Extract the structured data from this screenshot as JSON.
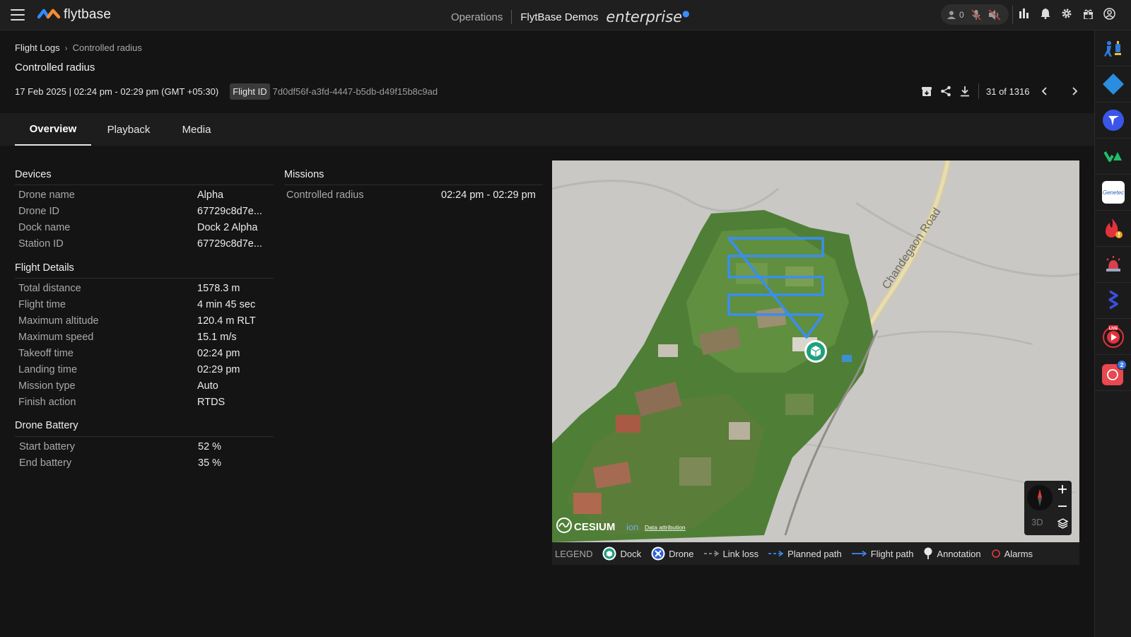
{
  "topbar": {
    "brand": "flytbase",
    "nav_operations": "Operations",
    "org_name": "FlytBase Demos",
    "edition": "enterprise",
    "user_count": "0"
  },
  "breadcrumb": {
    "root": "Flight Logs",
    "current": "Controlled radius"
  },
  "page_title": "Controlled radius",
  "meta": {
    "date_range": "17 Feb 2025 | 02:24 pm - 02:29 pm (GMT +05:30)",
    "flight_id_label": "Flight ID",
    "flight_id": "7d0df56f-a3fd-4447-b5db-d49f15b8c9ad",
    "pager": "31 of 1316"
  },
  "tabs": [
    {
      "label": "Overview",
      "active": true
    },
    {
      "label": "Playback",
      "active": false
    },
    {
      "label": "Media",
      "active": false
    }
  ],
  "devices": {
    "heading": "Devices",
    "rows": [
      {
        "label": "Drone name",
        "value": "Alpha"
      },
      {
        "label": "Drone ID",
        "value": "67729c8d7e..."
      },
      {
        "label": "Dock name",
        "value": "Dock 2 Alpha"
      },
      {
        "label": "Station ID",
        "value": "67729c8d7e..."
      }
    ]
  },
  "flight_details": {
    "heading": "Flight Details",
    "rows": [
      {
        "label": "Total distance",
        "value": "1578.3 m"
      },
      {
        "label": "Flight time",
        "value": "4 min 45 sec"
      },
      {
        "label": "Maximum altitude",
        "value": "120.4 m RLT"
      },
      {
        "label": "Maximum speed",
        "value": "15.1 m/s"
      },
      {
        "label": "Takeoff time",
        "value": "02:24 pm"
      },
      {
        "label": "Landing time",
        "value": "02:29 pm"
      },
      {
        "label": "Mission type",
        "value": "Auto"
      },
      {
        "label": "Finish action",
        "value": "RTDS"
      }
    ]
  },
  "battery": {
    "heading": "Drone Battery",
    "rows": [
      {
        "label": "Start battery",
        "value": "52 %"
      },
      {
        "label": "End battery",
        "value": "35 %"
      }
    ]
  },
  "missions": {
    "heading": "Missions",
    "rows": [
      {
        "label": "Controlled radius",
        "value": "02:24 pm - 02:29 pm"
      }
    ]
  },
  "map": {
    "road_label": "Chandegaon Road",
    "provider": "CESIUM",
    "provider_suffix": "ion",
    "attribution": "Data attribution",
    "mode_3d": "3D",
    "flight_path_color": "#3a8ef0"
  },
  "legend": {
    "title": "LEGEND",
    "items": [
      "Dock",
      "Drone",
      "Link loss",
      "Planned path",
      "Flight path",
      "Annotation",
      "Alarms"
    ]
  },
  "rightbar": {
    "badge_count": "2",
    "live_label": "LIVE",
    "genetec_label": "Genetec"
  }
}
